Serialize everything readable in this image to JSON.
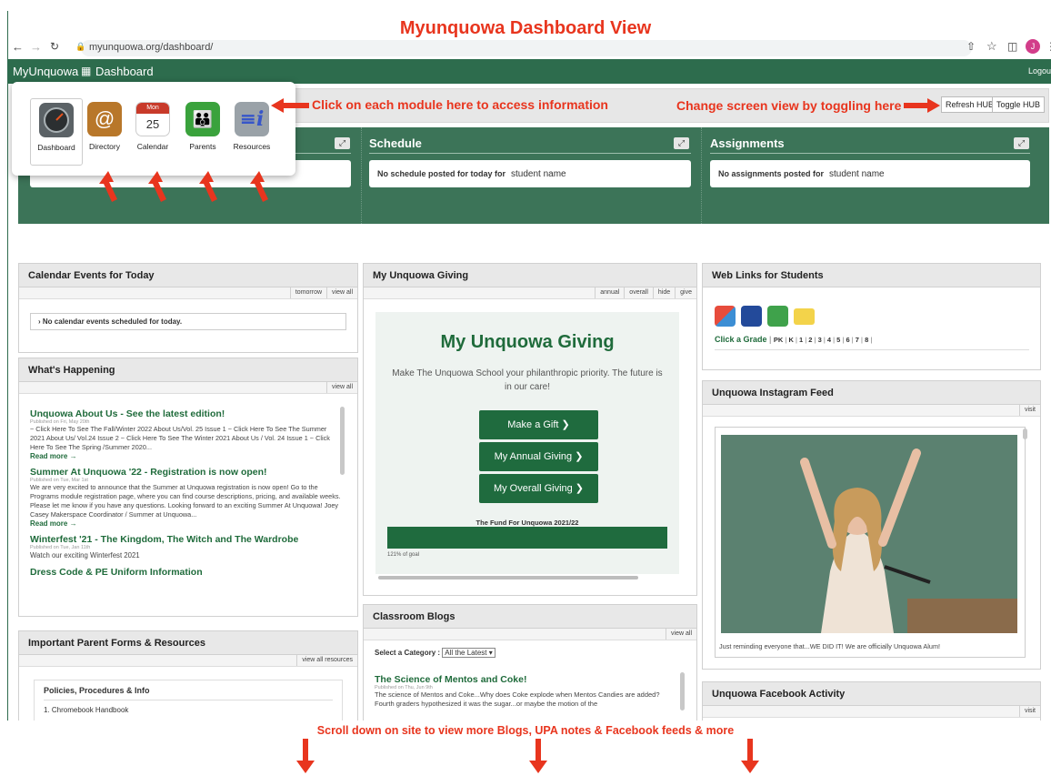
{
  "top_title": "Myunquowa Dashboard View",
  "browser": {
    "url": "myunquowa.org/dashboard/",
    "avatar": "J"
  },
  "nav": {
    "brand": "MyUnquowa",
    "section": "Dashboard",
    "logout": "Logou"
  },
  "hub_buttons": {
    "refresh": "Refresh HUB",
    "toggle": "Toggle HUB"
  },
  "hub": {
    "schedule": {
      "title": "Schedule",
      "message": "No schedule posted for today for",
      "name": "student name"
    },
    "assignments": {
      "title": "Assignments",
      "message": "No assignments posted for",
      "name": "student name"
    }
  },
  "modules": [
    {
      "label": "Dashboard",
      "icon": "gauge-icon"
    },
    {
      "label": "Directory",
      "icon": "at-sign-icon"
    },
    {
      "label": "Calendar",
      "icon": "calendar-icon",
      "month": "Mon",
      "day": "25"
    },
    {
      "label": "Parents",
      "icon": "family-icon"
    },
    {
      "label": "Resources",
      "icon": "info-icon"
    }
  ],
  "annotations": {
    "modules": "Click on each module here to access information",
    "toggle": "Change screen view by toggling here",
    "scroll": "Scroll down on site to view more Blogs, UPA notes & Facebook feeds & more"
  },
  "calendar_events": {
    "title": "Calendar Events for Today",
    "actions": [
      "tomorrow",
      "view all"
    ],
    "empty": "No calendar events scheduled for today."
  },
  "whats_happening": {
    "title": "What's Happening",
    "actions": [
      "view all"
    ],
    "items": [
      {
        "title": "Unquowa About Us - See the latest edition!",
        "date": "Published on Fri, May 20th",
        "body": "~ Click Here To See The Fall/Winter 2022 About Us/Vol. 25 Issue 1 ~ Click Here To See The Summer 2021 About Us/ Vol.24 Issue 2 ~ Click Here To See The Winter 2021 About Us / Vol. 24 Issue 1 ~ Click Here To See The Spring /Summer 2020...",
        "more": "Read more →"
      },
      {
        "title": "Summer At Unquowa '22 - Registration is now open!",
        "date": "Published on Tue, Mar 1st",
        "body": "We are very excited to announce that the Summer at Unquowa registration is now open! Go to the Programs module registration page, where you can find course descriptions, pricing, and available weeks. Please let me know if you have any questions. Looking forward to an exciting Summer At Unquowa! Joey Casey Makerspace Coordinator / Summer at Unquowa...",
        "more": "Read more →"
      },
      {
        "title": "Winterfest '21 - The Kingdom, The Witch and The Wardrobe",
        "date": "Published on Tue, Jan 11th",
        "body": "Watch our exciting Winterfest 2021",
        "more": ""
      },
      {
        "title": "Dress Code & PE Uniform Information",
        "date": "",
        "body": "",
        "more": ""
      }
    ]
  },
  "parent_forms": {
    "title": "Important Parent Forms & Resources",
    "actions": [
      "view all resources"
    ],
    "section": "Policies, Procedures & Info",
    "items": [
      "1.  Chromebook Handbook"
    ]
  },
  "giving": {
    "title": "My Unquowa Giving",
    "actions": [
      "annual",
      "overall",
      "hide",
      "give"
    ],
    "heading": "My Unquowa Giving",
    "subtitle": "Make The Unquowa School your philanthropic priority. The future is in our care!",
    "buttons": [
      "Make a Gift  ❯",
      "My Annual Giving  ❯",
      "My Overall Giving  ❯"
    ],
    "fund": "The Fund For Unquowa 2021/22",
    "progress_pct": 121,
    "progress_label": "121% of goal"
  },
  "blogs": {
    "title": "Classroom Blogs",
    "actions": [
      "view all"
    ],
    "category_label": "Select a Category :",
    "category_value": "All the Latest",
    "post_title": "The Science of Mentos and Coke!",
    "post_date": "Published on Thu, Jun 9th",
    "post_body": "The science of Mentos and Coke...Why does Coke explode when Mentos Candies are added? Fourth graders hypothesized it was the sugar...or maybe the motion of the"
  },
  "web_links": {
    "title": "Web Links for Students",
    "grade_label": "Click a Grade",
    "grades": [
      "PK",
      "K",
      "1",
      "2",
      "3",
      "4",
      "5",
      "6",
      "7",
      "8"
    ]
  },
  "instagram": {
    "title": "Unquowa Instagram Feed",
    "actions": [
      "visit"
    ],
    "caption": "Just reminding everyone that...WE DID IT! We are officially Unquowa Alum!"
  },
  "facebook": {
    "title": "Unquowa Facebook Activity",
    "actions": [
      "visit"
    ]
  },
  "colors": {
    "brand_green": "#2d6c4d",
    "annotation_red": "#e8351e",
    "link_green": "#1f6b3b"
  }
}
